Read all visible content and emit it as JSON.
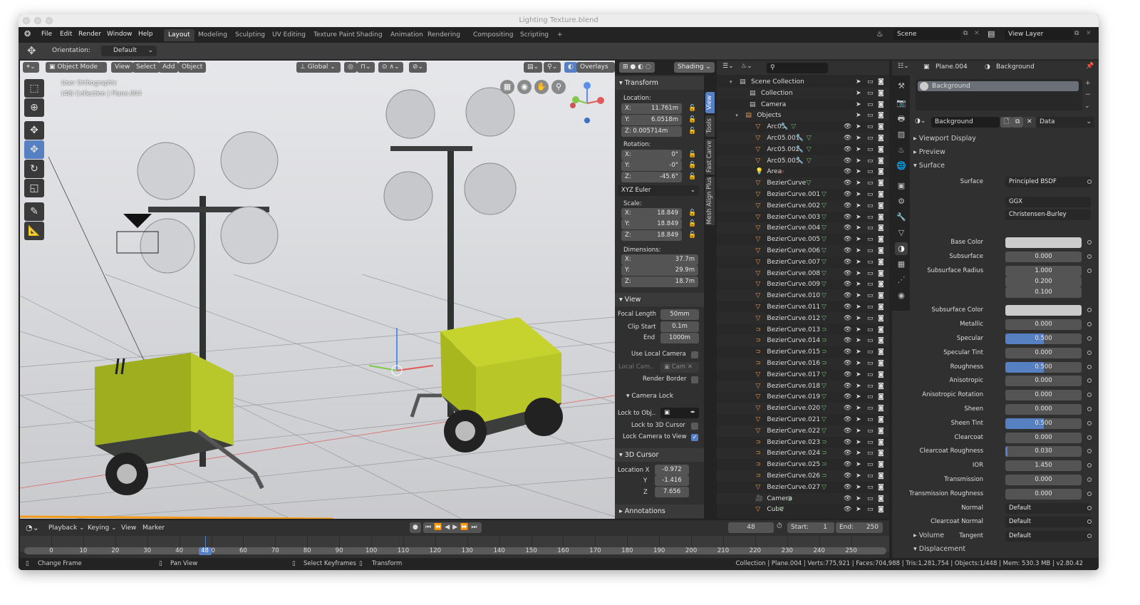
{
  "window": {
    "title": "Lighting Texture.blend"
  },
  "menu": [
    "File",
    "Edit",
    "Render",
    "Window",
    "Help"
  ],
  "workspaces": [
    "Layout",
    "Modeling",
    "Sculpting",
    "UV Editing",
    "Texture Paint",
    "Shading",
    "Animation",
    "Rendering",
    "Compositing",
    "Scripting",
    "+"
  ],
  "active_workspace": "Layout",
  "scene": {
    "scene_name": "Scene",
    "view_layer": "View Layer"
  },
  "toolsettings": {
    "orientation_label": "Orientation:",
    "orientation_value": "Default"
  },
  "viewport": {
    "header": {
      "mode": "Object Mode",
      "view": "View",
      "select": "Select",
      "add": "Add",
      "object": "Object",
      "transform_orientation": "Global",
      "overlays": "Overlays",
      "shading": "Shading"
    },
    "info_line1": "User Orthographic",
    "info_line2": "(48) Collection | Plane.004"
  },
  "npanel": {
    "tabs": [
      "View",
      "Tools",
      "Fast Carve",
      "Mesh Align Plus"
    ],
    "transform": {
      "title": "Transform",
      "location_label": "Location:",
      "loc_x": "X:",
      "loc_x_val": "11.761m",
      "loc_y": "Y:",
      "loc_y_val": "6.0518m",
      "loc_z_text": "Z: 0.005714m",
      "rotation_label": "Rotation:",
      "rot_x_val": "0°",
      "rot_y_val": "-0°",
      "rot_z_val": "-45.6°",
      "rotation_mode": "XYZ Euler",
      "scale_label": "Scale:",
      "scale_x": "18.849",
      "scale_y": "18.849",
      "scale_z": "18.849",
      "dimensions_label": "Dimensions:",
      "dim_x": "37.7m",
      "dim_y": "29.9m",
      "dim_z": "18.7m",
      "x": "X:",
      "y": "Y:",
      "z": "Z:"
    },
    "view": {
      "title": "View",
      "focal_length_label": "Focal Length",
      "focal_length": "50mm",
      "clip_start_label": "Clip Start",
      "clip_start": "0.1m",
      "end_label": "End",
      "clip_end": "1000m",
      "use_local_camera": "Use Local Camera",
      "local_cam_label": "Local Cam..",
      "local_cam_value": "Cam",
      "render_border": "Render Border",
      "camera_lock": "Camera Lock",
      "lock_to_obj": "Lock to Obj..",
      "lock_to_cursor": "Lock to 3D Cursor",
      "lock_camera_to_view": "Lock Camera to View",
      "lock_camera_to_view_checked": true
    },
    "cursor": {
      "title": "3D Cursor",
      "location_x_label": "Location X",
      "y_label": "Y",
      "z_label": "Z",
      "x": "-0.972",
      "y": "-1.416",
      "z": "7.656"
    },
    "annotations": "Annotations"
  },
  "outliner": {
    "scene_collection": "Scene Collection",
    "collections": [
      "Collection",
      "Camera"
    ],
    "objects_label": "Objects",
    "objects": [
      {
        "name": "Arc05",
        "type": "mesh",
        "modifier": true
      },
      {
        "name": "Arc05.001",
        "type": "mesh",
        "modifier": true
      },
      {
        "name": "Arc05.002",
        "type": "mesh",
        "modifier": true
      },
      {
        "name": "Arc05.003",
        "type": "mesh",
        "modifier": true
      },
      {
        "name": "Area",
        "type": "light"
      },
      {
        "name": "BezierCurve",
        "type": "mesh"
      },
      {
        "name": "BezierCurve.001",
        "type": "mesh"
      },
      {
        "name": "BezierCurve.002",
        "type": "mesh"
      },
      {
        "name": "BezierCurve.003",
        "type": "mesh"
      },
      {
        "name": "BezierCurve.004",
        "type": "mesh"
      },
      {
        "name": "BezierCurve.005",
        "type": "mesh"
      },
      {
        "name": "BezierCurve.006",
        "type": "mesh"
      },
      {
        "name": "BezierCurve.007",
        "type": "mesh"
      },
      {
        "name": "BezierCurve.008",
        "type": "mesh"
      },
      {
        "name": "BezierCurve.009",
        "type": "mesh"
      },
      {
        "name": "BezierCurve.010",
        "type": "mesh"
      },
      {
        "name": "BezierCurve.011",
        "type": "mesh"
      },
      {
        "name": "BezierCurve.012",
        "type": "mesh"
      },
      {
        "name": "BezierCurve.013",
        "type": "curve"
      },
      {
        "name": "BezierCurve.014",
        "type": "curve"
      },
      {
        "name": "BezierCurve.015",
        "type": "curve"
      },
      {
        "name": "BezierCurve.016",
        "type": "curve"
      },
      {
        "name": "BezierCurve.017",
        "type": "mesh"
      },
      {
        "name": "BezierCurve.018",
        "type": "mesh"
      },
      {
        "name": "BezierCurve.019",
        "type": "mesh"
      },
      {
        "name": "BezierCurve.020",
        "type": "mesh"
      },
      {
        "name": "BezierCurve.021",
        "type": "mesh"
      },
      {
        "name": "BezierCurve.022",
        "type": "mesh"
      },
      {
        "name": "BezierCurve.023",
        "type": "curve"
      },
      {
        "name": "BezierCurve.024",
        "type": "curve"
      },
      {
        "name": "BezierCurve.025",
        "type": "curve"
      },
      {
        "name": "BezierCurve.026",
        "type": "curve"
      },
      {
        "name": "BezierCurve.027",
        "type": "mesh"
      },
      {
        "name": "Camera",
        "type": "camera"
      },
      {
        "name": "Cube",
        "type": "mesh"
      }
    ]
  },
  "properties": {
    "object": "Plane.004",
    "material": "Background",
    "slot": "Background",
    "material_name": "Background",
    "link": "Data",
    "sections": {
      "viewport_display": "Viewport Display",
      "preview": "Preview",
      "surface": "Surface",
      "volume": "Volume",
      "displacement": "Displacement"
    },
    "surface_label": "Surface",
    "surface_value": "Principled BSDF",
    "distribution": "GGX",
    "subsurface_method": "Christensen-Burley",
    "fields": [
      {
        "label": "Base Color",
        "kind": "color",
        "color": "#cccccc"
      },
      {
        "label": "Subsurface",
        "value": "0.000",
        "fraction": 0
      },
      {
        "label": "Subsurface Radius",
        "value": "1.000",
        "fraction": 0
      },
      {
        "label": "",
        "value": "0.200",
        "fraction": 0
      },
      {
        "label": "",
        "value": "0.100",
        "fraction": 0
      },
      {
        "label": "Subsurface Color",
        "kind": "color",
        "color": "#cccccc"
      },
      {
        "label": "Metallic",
        "value": "0.000",
        "fraction": 0
      },
      {
        "label": "Specular",
        "value": "0.500",
        "fraction": 0.5
      },
      {
        "label": "Specular Tint",
        "value": "0.000",
        "fraction": 0
      },
      {
        "label": "Roughness",
        "value": "0.500",
        "fraction": 0.5
      },
      {
        "label": "Anisotropic",
        "value": "0.000",
        "fraction": 0
      },
      {
        "label": "Anisotropic Rotation",
        "value": "0.000",
        "fraction": 0
      },
      {
        "label": "Sheen",
        "value": "0.000",
        "fraction": 0
      },
      {
        "label": "Sheen Tint",
        "value": "0.500",
        "fraction": 0.5
      },
      {
        "label": "Clearcoat",
        "value": "0.000",
        "fraction": 0
      },
      {
        "label": "Clearcoat Roughness",
        "value": "0.030",
        "fraction": 0.03
      },
      {
        "label": "IOR",
        "value": "1.450",
        "fraction": 0
      },
      {
        "label": "Transmission",
        "value": "0.000",
        "fraction": 0
      },
      {
        "label": "Transmission Roughness",
        "value": "0.000",
        "fraction": 0
      },
      {
        "label": "Normal",
        "kind": "drop",
        "value": "Default"
      },
      {
        "label": "Clearcoat Normal",
        "kind": "drop",
        "value": "Default"
      },
      {
        "label": "Tangent",
        "kind": "drop",
        "value": "Default"
      }
    ]
  },
  "timeline": {
    "menus": [
      "Playback",
      "Keying",
      "View",
      "Marker"
    ],
    "current_frame": "48",
    "start_label": "Start:",
    "start": "1",
    "end_label": "End:",
    "end": "250",
    "ticks": [
      "0",
      "10",
      "20",
      "30",
      "40",
      "50",
      "60",
      "70",
      "80",
      "90",
      "100",
      "110",
      "120",
      "130",
      "140",
      "150",
      "160",
      "170",
      "180",
      "190",
      "200",
      "210",
      "220",
      "230",
      "240",
      "250"
    ]
  },
  "status": {
    "change_frame": "Change Frame",
    "pan_view": "Pan View",
    "select_keyframes": "Select Keyframes",
    "transform": "Transform",
    "info": "Collection | Plane.004 | Verts:775,921 | Faces:704,988 | Tris:1,281,754 | Objects:1/448 | Mem: 530.3 MB | v2.80.42"
  },
  "colors": {
    "accent": "#5680c2",
    "mesh_icon": "#e8954a",
    "data_icon": "#6fb56f"
  }
}
